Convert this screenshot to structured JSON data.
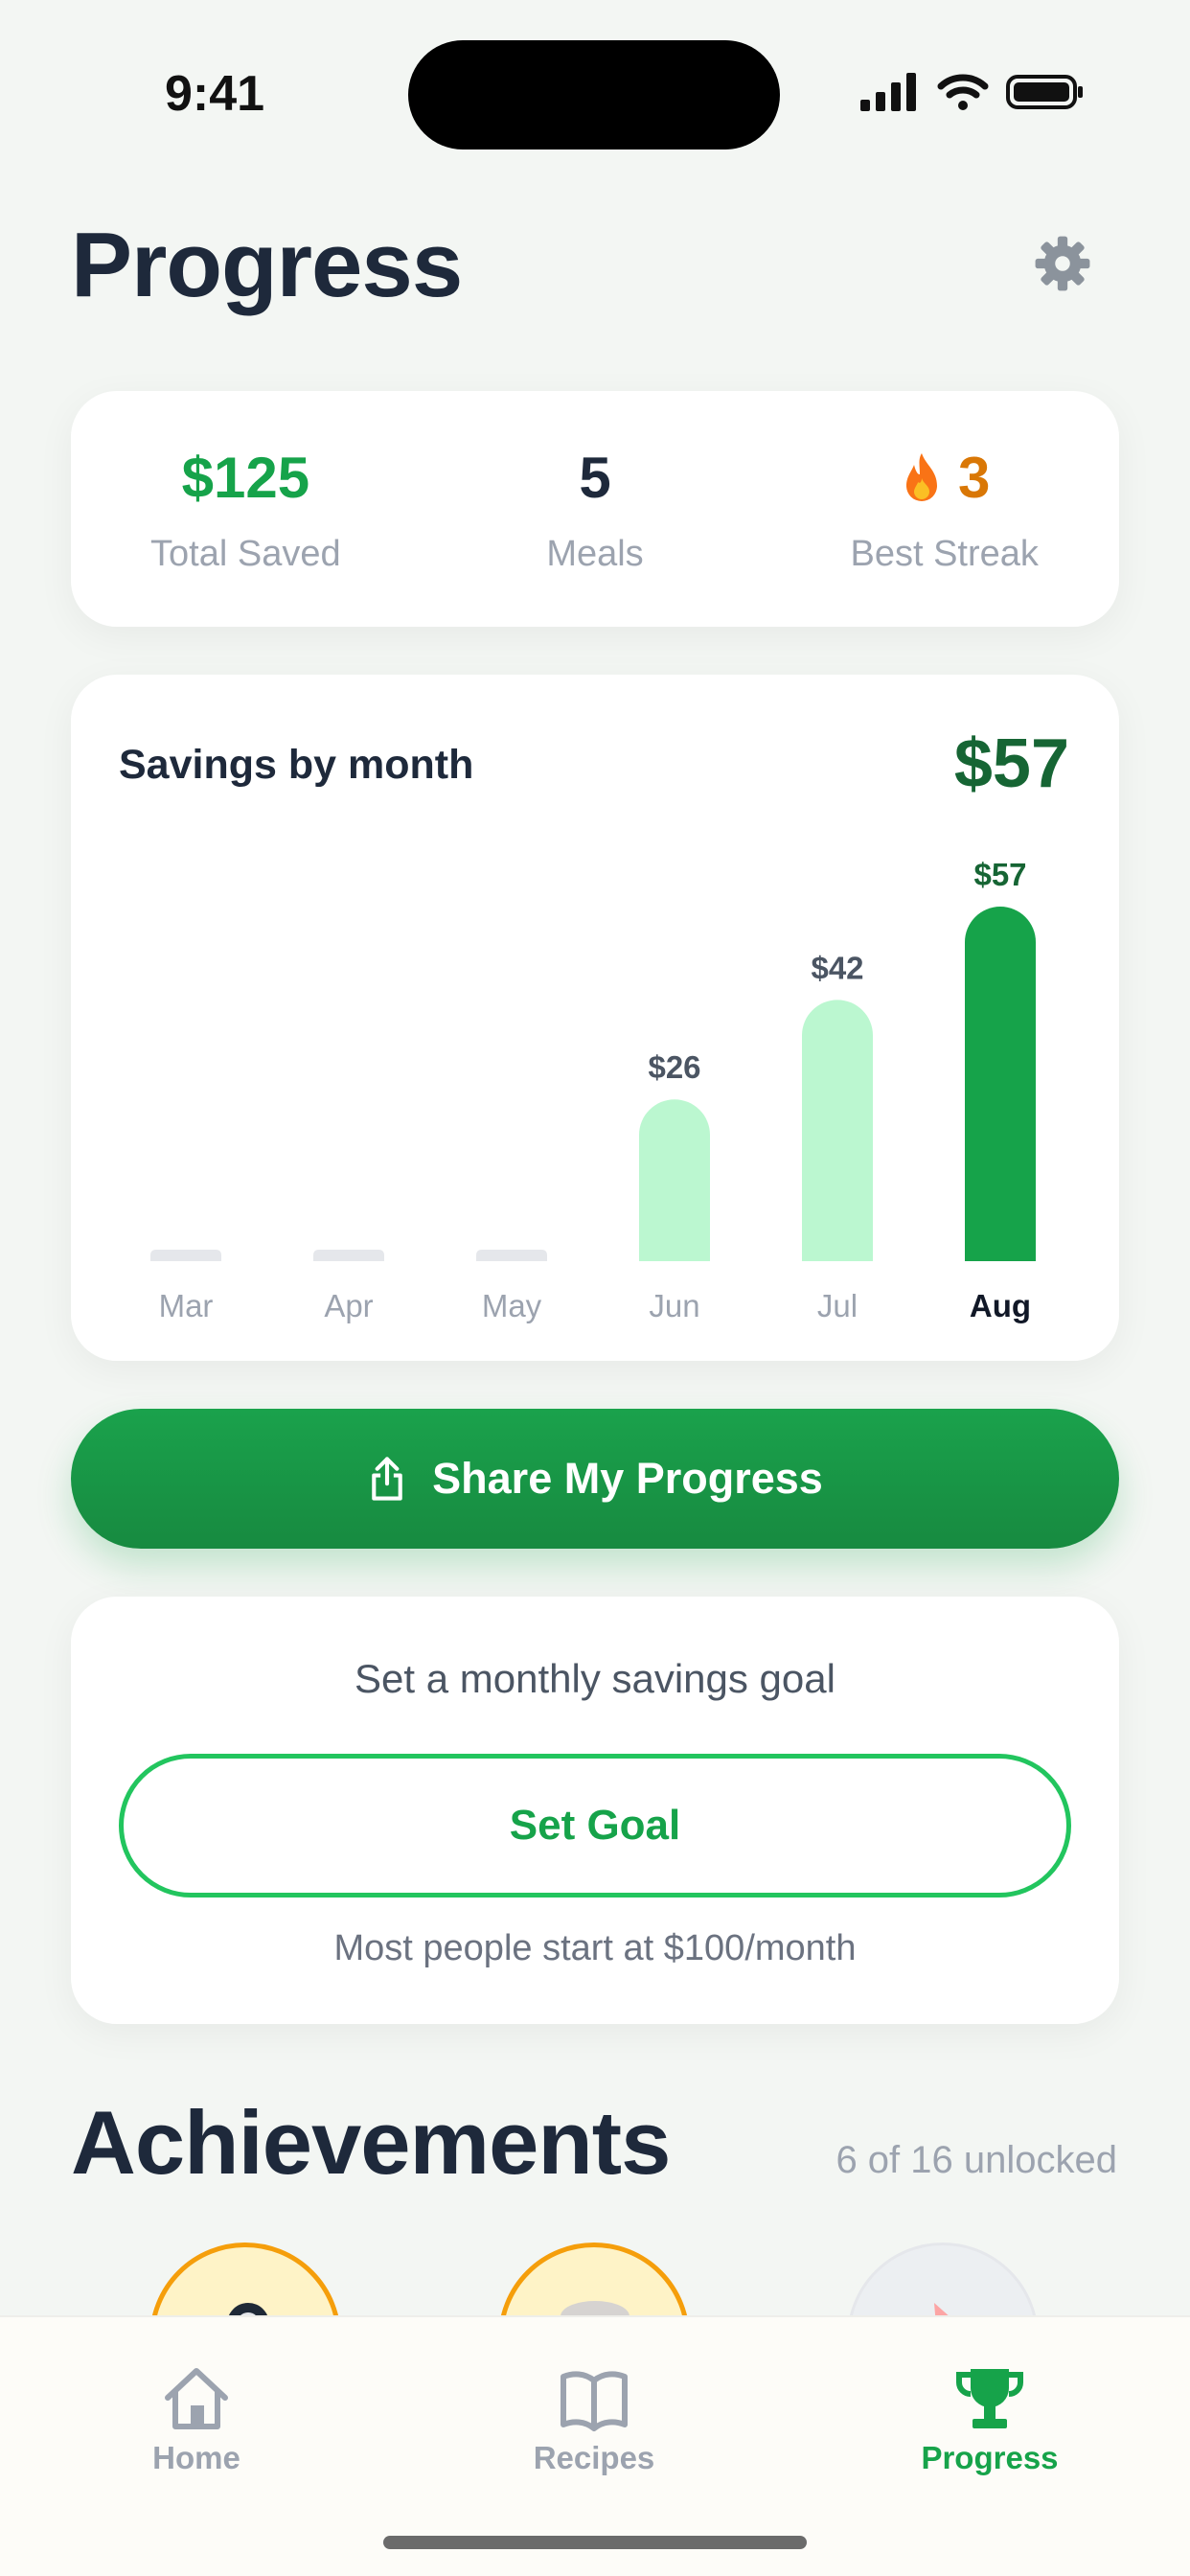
{
  "status_bar": {
    "time": "9:41"
  },
  "header": {
    "title": "Progress"
  },
  "stats": [
    {
      "value": "$125",
      "label": "Total Saved",
      "color": "#16a34a"
    },
    {
      "value": "5",
      "label": "Meals",
      "color": "#1e293b"
    },
    {
      "value": "3",
      "label": "Best Streak",
      "color": "#d97706",
      "icon": "fire-icon"
    }
  ],
  "chart": {
    "title": "Savings by month",
    "total": "$57"
  },
  "chart_data": {
    "type": "bar",
    "title": "Savings by month",
    "categories": [
      "Mar",
      "Apr",
      "May",
      "Jun",
      "Jul",
      "Aug"
    ],
    "values": [
      0,
      0,
      0,
      26,
      42,
      57
    ],
    "value_labels": [
      "",
      "",
      "",
      "$26",
      "$42",
      "$57"
    ],
    "highlight": "Aug",
    "colors": {
      "past": "#bbf7d0",
      "current": "#16a34a",
      "empty": "#e5e7eb"
    },
    "grid": false
  },
  "share": {
    "label": "Share My Progress"
  },
  "goal": {
    "prompt": "Set a monthly savings goal",
    "button": "Set Goal",
    "hint": "Most people start at $100/month"
  },
  "achievements": {
    "title": "Achievements",
    "count": "6 of 16 unlocked"
  },
  "tabs": [
    {
      "label": "Home",
      "icon": "home-icon"
    },
    {
      "label": "Recipes",
      "icon": "book-icon"
    },
    {
      "label": "Progress",
      "icon": "trophy-icon",
      "active": true
    }
  ]
}
